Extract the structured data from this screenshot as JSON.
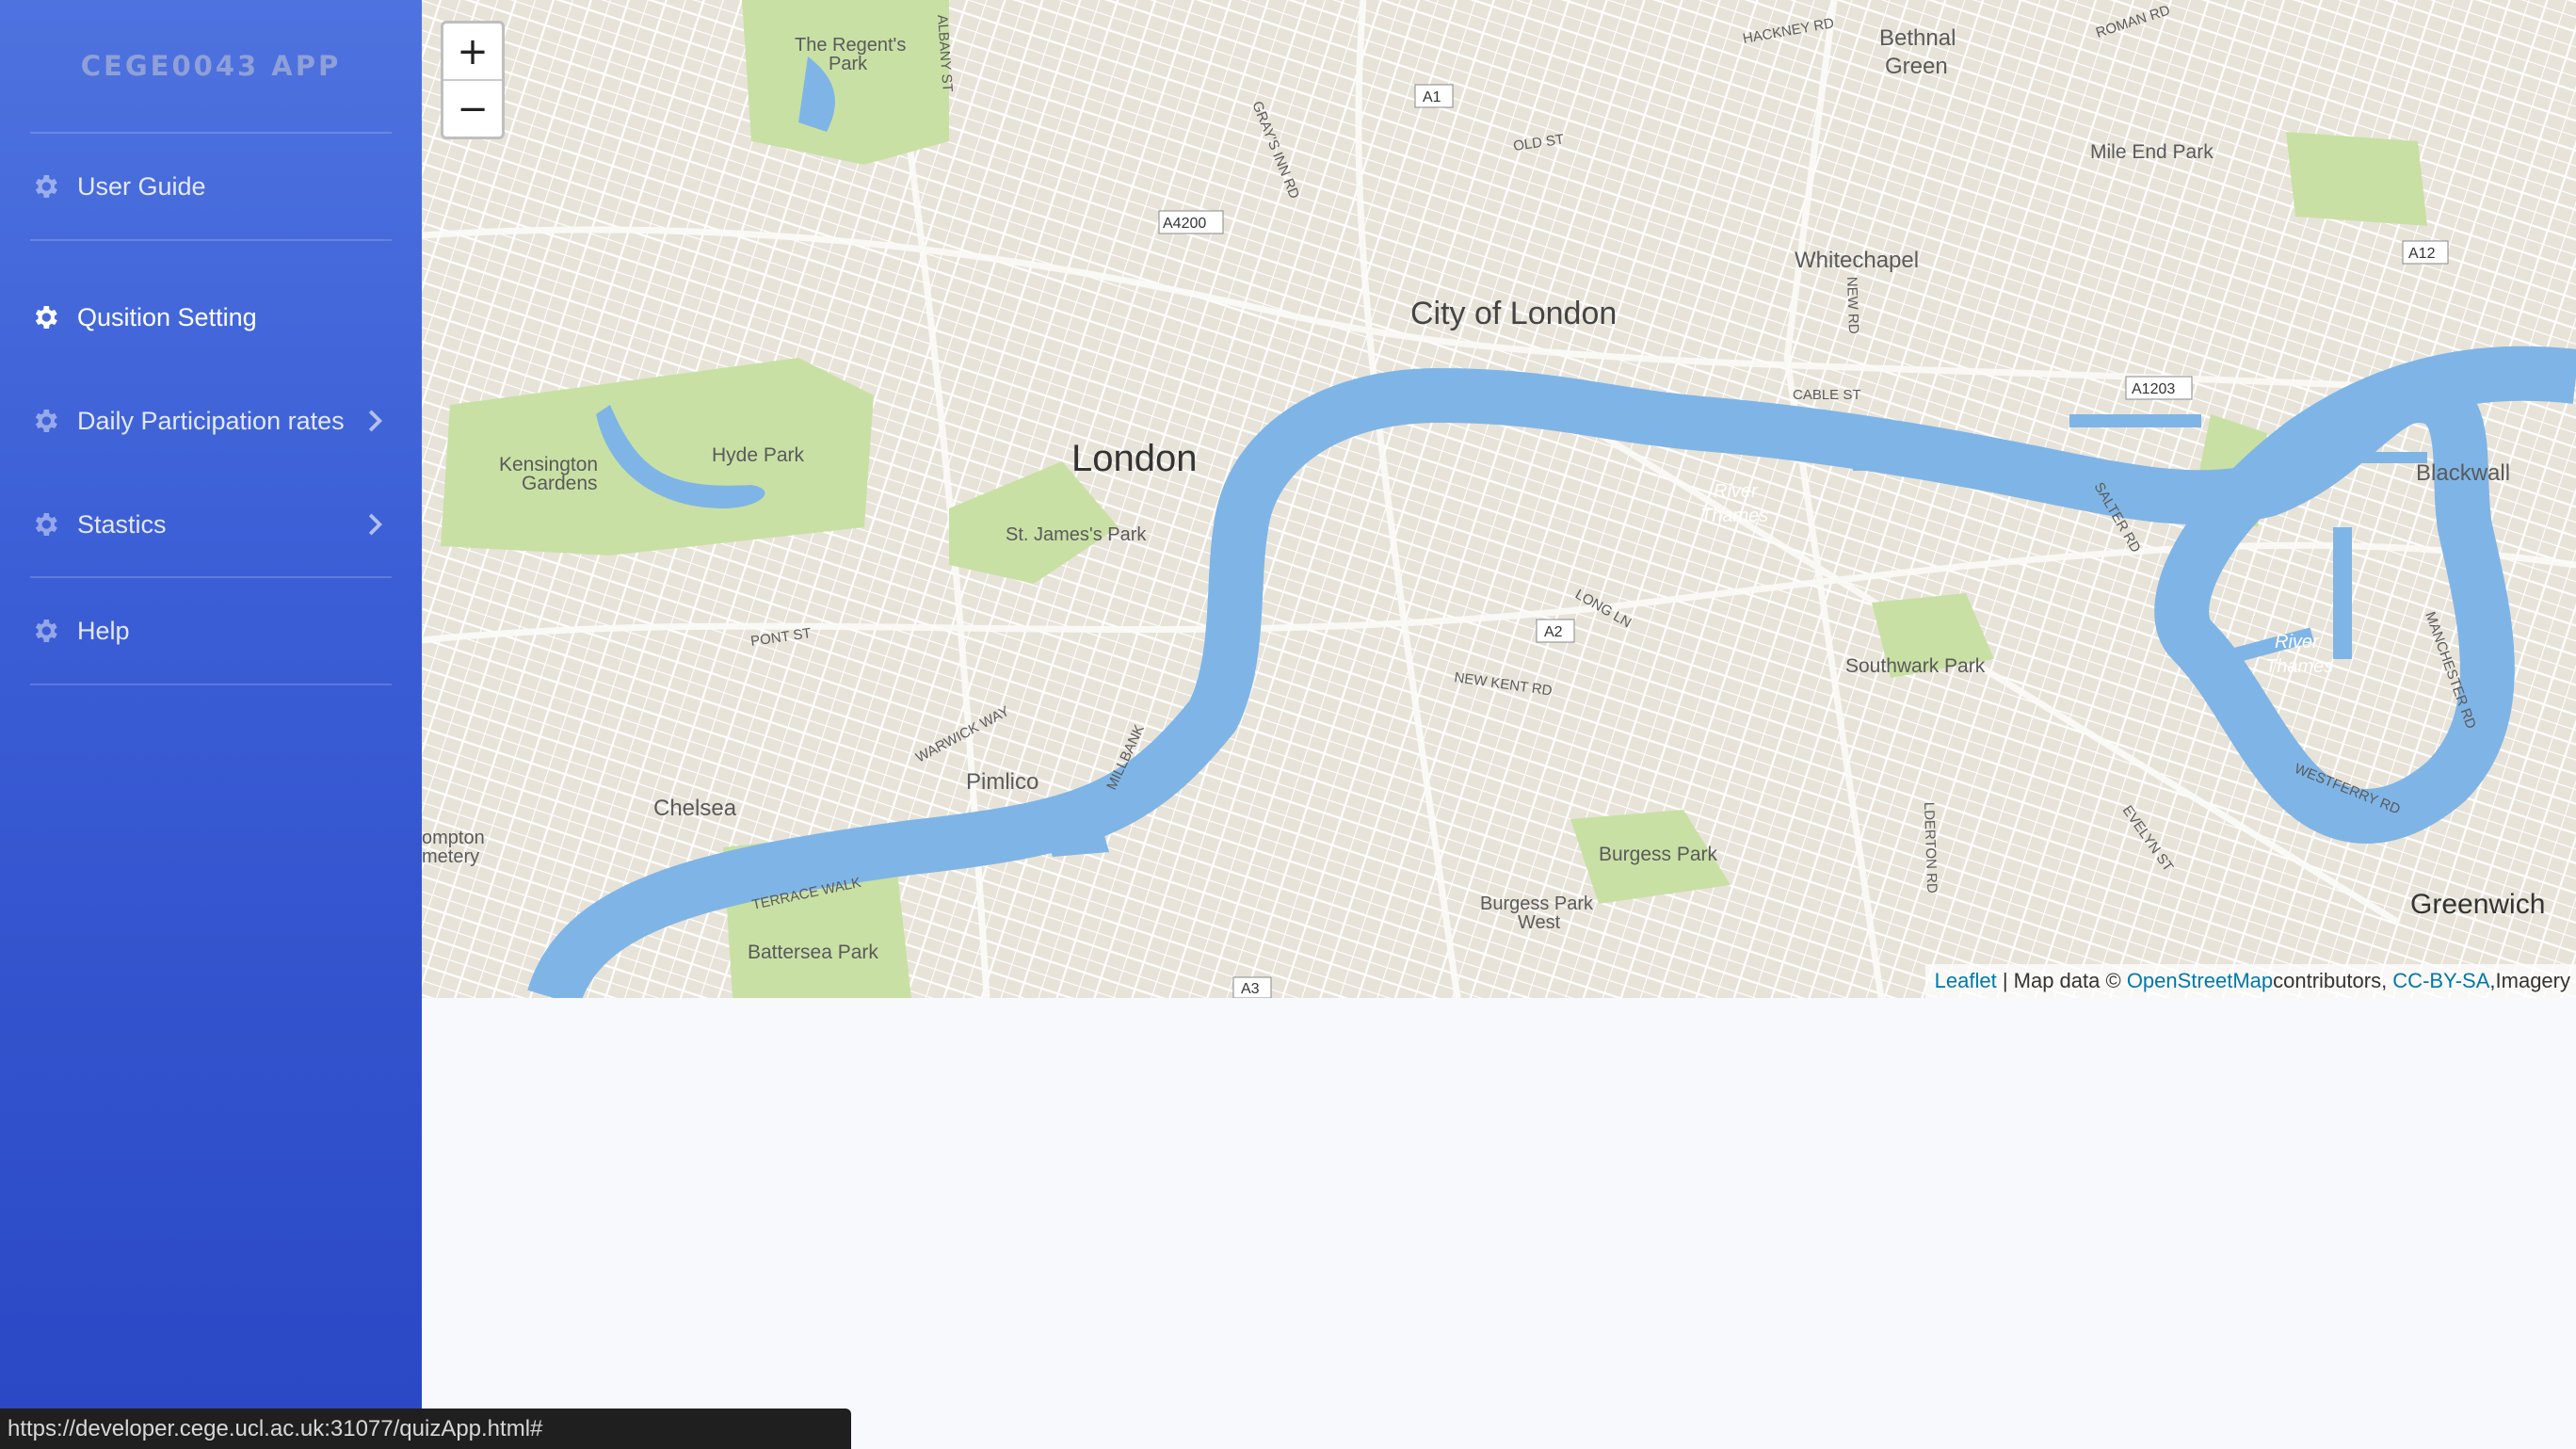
{
  "app": {
    "title": "CEGE0043 APP"
  },
  "sidebar": {
    "items": [
      {
        "label": "User Guide",
        "icon": "gear-icon",
        "has_submenu": false
      },
      {
        "label": "Qusition Setting",
        "icon": "gear-icon",
        "has_submenu": false
      },
      {
        "label": "Daily Participation rates",
        "icon": "gear-icon",
        "has_submenu": true
      },
      {
        "label": "Stastics",
        "icon": "gear-icon",
        "has_submenu": true
      },
      {
        "label": "Help",
        "icon": "gear-icon",
        "has_submenu": false
      }
    ]
  },
  "map": {
    "zoom_in_label": "+",
    "zoom_out_label": "−",
    "places": {
      "london": "London",
      "city_of_london": "City of London",
      "hyde_park": "Hyde Park",
      "kensington_gardens_1": "Kensington",
      "kensington_gardens_2": "Gardens",
      "regents_park_1": "The Regent's",
      "regents_park_2": "Park",
      "st_james_park": "St. James's Park",
      "whitechapel": "Whitechapel",
      "bethnal_green_1": "Bethnal",
      "bethnal_green_2": "Green",
      "mile_end_park": "Mile End Park",
      "blackwall": "Blackwall",
      "southwark_park": "Southwark Park",
      "burgess_park": "Burgess Park",
      "burgess_park_west_1": "Burgess Park",
      "burgess_park_west_2": "West",
      "pimlico": "Pimlico",
      "chelsea": "Chelsea",
      "battersea_park": "Battersea Park",
      "greenwich": "Greenwich",
      "river_thames_1": "River",
      "river_thames_2": "Thames",
      "brompton_1": "ompton",
      "brompton_2": "metery"
    },
    "roads": {
      "a1": "A1",
      "a4200": "A4200",
      "a12": "A12",
      "a1203": "A1203",
      "a2": "A2",
      "a3": "A3",
      "old_st": "OLD ST",
      "cable_st": "CABLE ST",
      "hackney_rd": "HACKNEY RD",
      "roman_rd": "ROMAN RD",
      "new_kent_rd": "NEW KENT RD",
      "long_ln": "LONG LN",
      "pont_st": "PONT ST",
      "warwick_way": "WARWICK WAY",
      "millbank": "MILLBANK",
      "terrace_walk": "TERRACE WALK",
      "salter_rd": "SALTER RD",
      "westferry_rd": "WESTFERRY RD",
      "evelyn_st": "EVELYN ST",
      "manchester_rd": "MANCHESTER RD",
      "grays_inn_rd": "GRAY'S INN RD",
      "albany_st": "ALBANY ST",
      "new_rd": "NEW RD",
      "alderton_rd": "LDERTON RD"
    },
    "attribution": {
      "leaflet": "Leaflet",
      "map_data": " | Map data © ",
      "osm": "OpenStreetMap",
      "contributors": "contributors, ",
      "license": "CC-BY-SA",
      "imagery": ",Imagery"
    }
  },
  "statusbar": {
    "url": "https://developer.cege.ucl.ac.uk:31077/quizApp.html#"
  },
  "colors": {
    "sidebar_top": "#4e73df",
    "sidebar_bottom": "#2a47c4",
    "water": "#7fb5e6",
    "park": "#c8dfa4",
    "land": "#e9e5dc"
  }
}
